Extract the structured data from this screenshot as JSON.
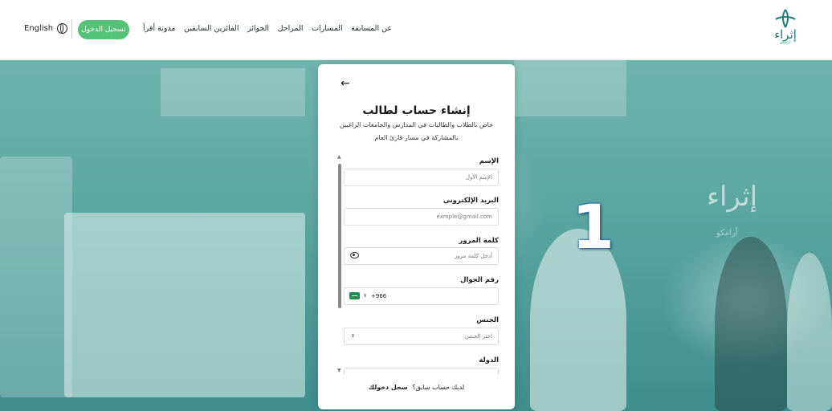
{
  "header": {
    "language": "English",
    "login_button": "تسجيل الدخول",
    "nav": [
      "عن المسابقة",
      "المسارات",
      "المراحل",
      "الجوائز",
      "الفائزين السابقين",
      "مدونة أقرأ"
    ],
    "logo_text": "إثراء",
    "logo_sub": "أرامكو"
  },
  "background": {
    "logo_text": "إثراء",
    "logo_sub": "أرامكو",
    "step_number": "1"
  },
  "modal": {
    "title": "إنشاء حساب لطالب",
    "subtitle": "خاص بالطلاب والطالبات في المدارس والجامعات الراغبين بالمشاركة في مسار قارئ العام",
    "fields": {
      "name": {
        "label": "الإسم",
        "placeholder": "الإسم الأول"
      },
      "email": {
        "label": "البريد الإلكتروني",
        "placeholder": "exmple@gmail.com"
      },
      "password": {
        "label": "كلمة المرور",
        "placeholder": "أدخل كلمة مرور"
      },
      "phone": {
        "label": "رقم الجوال",
        "dial_code": "+966"
      },
      "gender": {
        "label": "الجنس",
        "placeholder": "اختر الجنس"
      },
      "country": {
        "label": "الدولة"
      }
    },
    "have_account": "لديك حساب سابق؟",
    "login_link": "سجل دخولك"
  },
  "colors": {
    "brand_green": "#54c277",
    "teal": "#1b7a76"
  }
}
